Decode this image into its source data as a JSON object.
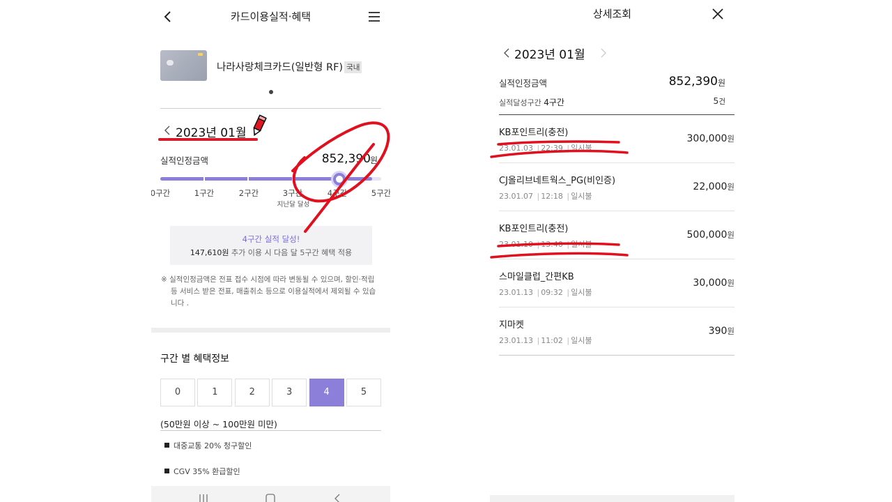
{
  "left": {
    "title": "카드이용실적·혜택",
    "card": {
      "name": "나라사랑체크카드(일반형 RF)",
      "badge": "국내"
    },
    "month": "2023년 01월",
    "performance": {
      "label": "실적인정금액",
      "amount": "852,390",
      "unit": "원",
      "progress_level": 4.8
    },
    "segments": [
      "0구간",
      "1구간",
      "2구간",
      "3구간",
      "4구간",
      "5구간"
    ],
    "segment_note": "지난달 달성",
    "achieve": {
      "title": "4구간 실적 달성!",
      "amount": "147,610원",
      "message": " 추가 이용 시 다음 달 5구간 혜택 적용"
    },
    "notice": "※ 실적인정금액은 전표 접수 시점에 따라 변동될 수 있으며, 할인·적립 등 서비스 받은 전표, 매출취소 등으로 이용실적에서 제외될 수 있습니다 .",
    "benefit": {
      "title": "구간 별 혜택정보",
      "tabs": [
        "0",
        "1",
        "2",
        "3",
        "4",
        "5"
      ],
      "active_tab": 4,
      "range": "(50만원 이상 ~ 100만원 미만)",
      "items": [
        "대중교통 20% 청구할인",
        "CGV 35% 환급할인"
      ]
    }
  },
  "right": {
    "title": "상세조회",
    "month": "2023년 01월",
    "summary": {
      "label": "실적인정금액",
      "amount": "852,390",
      "unit": "원",
      "section_prefix": "실적달성구간",
      "section_value": "4구간",
      "count": "5",
      "count_unit": "건"
    },
    "transactions": [
      {
        "merchant": "KB포인트리(충전)",
        "date": "23.01.03",
        "time": "22:39",
        "type": "일시불",
        "amount": "300,000",
        "unit": "원"
      },
      {
        "merchant": "CJ올리브네트웍스_PG(비인증)",
        "date": "23.01.07",
        "time": "12:18",
        "type": "일시불",
        "amount": "22,000",
        "unit": "원"
      },
      {
        "merchant": "KB포인트리(충전)",
        "date": "23.01.10",
        "time": "13:40",
        "type": "일시불",
        "amount": "500,000",
        "unit": "원"
      },
      {
        "merchant": "스마일클럽_간편KB",
        "date": "23.01.13",
        "time": "09:32",
        "type": "일시불",
        "amount": "30,000",
        "unit": "원"
      },
      {
        "merchant": "지마켓",
        "date": "23.01.13",
        "time": "11:02",
        "type": "일시불",
        "amount": "390",
        "unit": "원"
      }
    ]
  },
  "colors": {
    "accent": "#8b7fd9",
    "annotation_red": "#e0101e"
  }
}
